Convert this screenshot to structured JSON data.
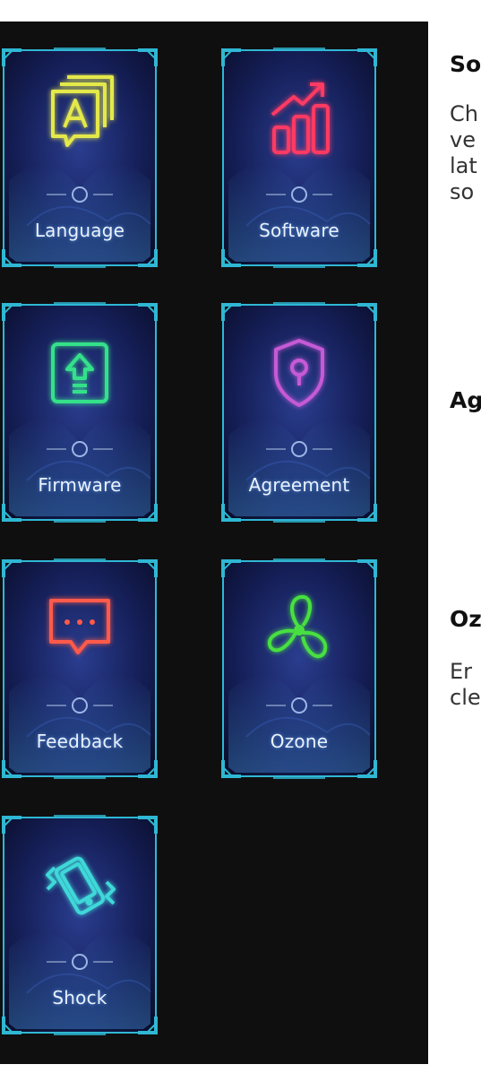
{
  "tiles": [
    {
      "name": "language",
      "label": "Language",
      "icon": "language-icon",
      "color": "#e4e84a"
    },
    {
      "name": "software",
      "label": "Software",
      "icon": "software-chart-icon",
      "color": "#ff3a63"
    },
    {
      "name": "firmware",
      "label": "Firmware",
      "icon": "firmware-upload-icon",
      "color": "#35e08a"
    },
    {
      "name": "agreement",
      "label": "Agreement",
      "icon": "shield-lock-icon",
      "color": "#c65ad6"
    },
    {
      "name": "feedback",
      "label": "Feedback",
      "icon": "chat-bubble-icon",
      "color": "#ff5a4a"
    },
    {
      "name": "ozone",
      "label": "Ozone",
      "icon": "fan-icon",
      "color": "#48e040"
    },
    {
      "name": "shock",
      "label": "Shock",
      "icon": "vibrating-phone-icon",
      "color": "#3fd8d8"
    }
  ],
  "descriptions": {
    "software": {
      "title": "So",
      "lines": [
        "Ch",
        "ve",
        "lat",
        "so"
      ]
    },
    "agreement": {
      "title": "Ag"
    },
    "ozone": {
      "title": "Oz",
      "lines": [
        "Er",
        "cle"
      ]
    }
  },
  "colors": {
    "panel_bg": "#0f0f10",
    "frame_cyan": "#2fb7d4",
    "label_text": "#e9f2ff"
  }
}
